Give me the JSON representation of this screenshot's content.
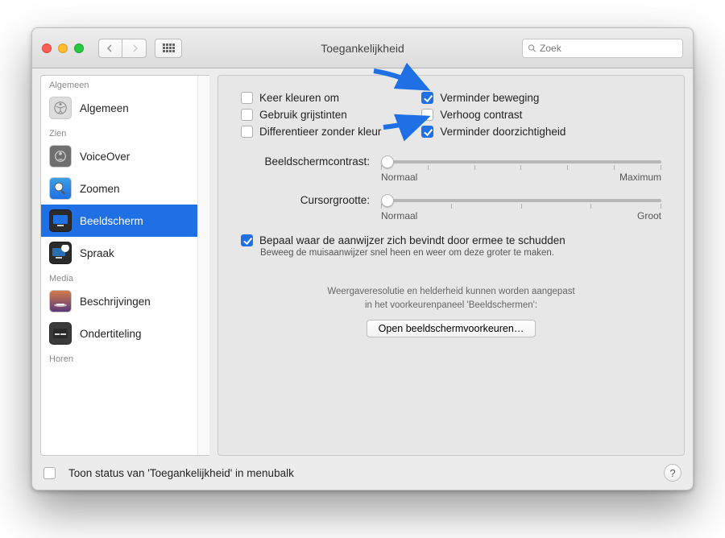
{
  "window": {
    "title": "Toegankelijkheid"
  },
  "search": {
    "placeholder": "Zoek"
  },
  "sidebar": {
    "sections": [
      {
        "header": "Algemeen",
        "items": [
          {
            "label": "Algemeen"
          }
        ]
      },
      {
        "header": "Zien",
        "items": [
          {
            "label": "VoiceOver"
          },
          {
            "label": "Zoomen"
          },
          {
            "label": "Beeldscherm",
            "selected": true
          },
          {
            "label": "Spraak"
          }
        ]
      },
      {
        "header": "Media",
        "items": [
          {
            "label": "Beschrijvingen"
          },
          {
            "label": "Ondertiteling"
          }
        ]
      },
      {
        "header": "Horen",
        "items": []
      }
    ]
  },
  "options": {
    "invert_colors": {
      "label": "Keer kleuren om",
      "checked": false
    },
    "grayscale": {
      "label": "Gebruik grijstinten",
      "checked": false
    },
    "diff_without_color": {
      "label": "Differentieer zonder kleur",
      "checked": false
    },
    "reduce_motion": {
      "label": "Verminder beweging",
      "checked": true
    },
    "increase_contrast": {
      "label": "Verhoog contrast",
      "checked": false
    },
    "reduce_transparency": {
      "label": "Verminder doorzichtigheid",
      "checked": true
    }
  },
  "sliders": {
    "contrast": {
      "label": "Beeldschermcontrast:",
      "min_label": "Normaal",
      "max_label": "Maximum"
    },
    "cursor": {
      "label": "Cursorgrootte:",
      "min_label": "Normaal",
      "max_label": "Groot"
    }
  },
  "shake": {
    "label": "Bepaal waar de aanwijzer zich bevindt door ermee te schudden",
    "sub": "Beweeg de muisaanwijzer snel heen en weer om deze groter te maken.",
    "checked": true
  },
  "hint": {
    "line1": "Weergaveresolutie en helderheid kunnen worden aangepast",
    "line2": "in het voorkeurenpaneel 'Beeldschermen':"
  },
  "open_button": "Open beeldschermvoorkeuren…",
  "footer": {
    "label": "Toon status van 'Toegankelijkheid' in menubalk",
    "checked": false
  },
  "help": "?"
}
